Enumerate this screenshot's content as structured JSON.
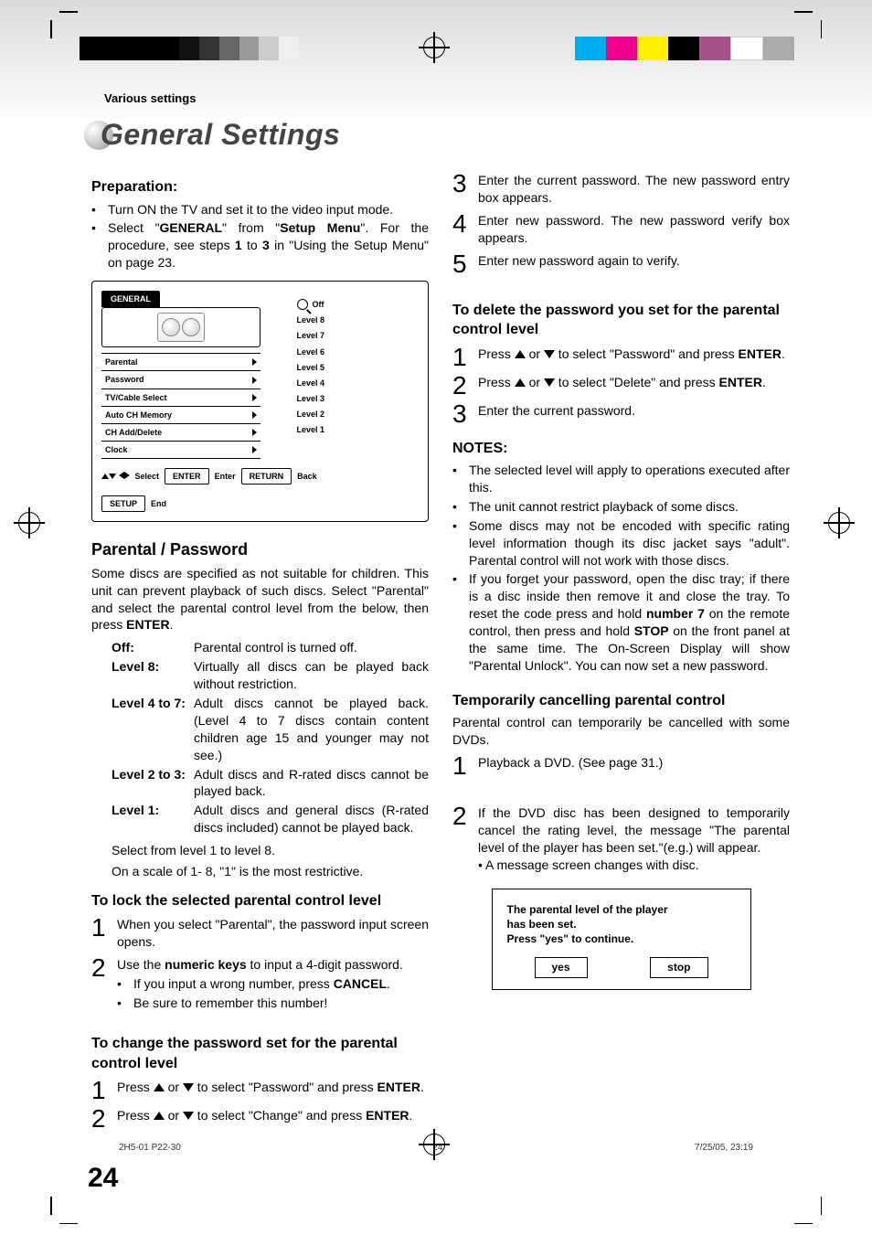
{
  "breadcrumb": "Various settings",
  "title": "General Settings",
  "preparation": {
    "heading": "Preparation:",
    "item1": "Turn ON the TV and set it to the video input mode.",
    "item2_a": "Select \"",
    "item2_b": "GENERAL",
    "item2_c": "\" from \"",
    "item2_d": "Setup Menu",
    "item2_e": "\". For the procedure, see steps ",
    "item2_f": "1",
    "item2_g": " to ",
    "item2_h": "3",
    "item2_i": " in \"Using the Setup Menu\" on page 23."
  },
  "osd": {
    "tab": "GENERAL",
    "menu": [
      "Parental",
      "Password",
      "TV/Cable Select",
      "Auto CH Memory",
      "CH Add/Delete",
      "Clock"
    ],
    "levels": [
      "Off",
      "Level 8",
      "Level 7",
      "Level 6",
      "Level 5",
      "Level 4",
      "Level 3",
      "Level 2",
      "Level 1"
    ],
    "footer": {
      "select": "Select",
      "enter": "ENTER",
      "enter2": "Enter",
      "return": "RETURN",
      "back": "Back",
      "setup": "SETUP",
      "end": "End"
    }
  },
  "section1": {
    "heading": "Parental / Password",
    "intro": "Some discs are specified as not suitable for children. This unit can prevent playback of such discs. Select \"Parental\" and select the parental control level from the below, then press ",
    "introB": "ENTER",
    "introEnd": ".",
    "defs": [
      {
        "k": "Off",
        "colon": ":",
        "v": "Parental control is turned off."
      },
      {
        "k": "Level 8",
        "colon": ":",
        "v": "Virtually all discs can be played back without restriction."
      },
      {
        "k": "Level 4 to 7",
        "colon": ":",
        "v": "Adult discs cannot be played back. (Level 4 to 7 discs contain content children age 15 and younger may not see.)"
      },
      {
        "k": "Level 2 to 3",
        "colon": ":",
        "v": "Adult discs and R-rated discs cannot be played back."
      },
      {
        "k": "Level 1",
        "colon": ":",
        "v": "Adult discs and general discs (R-rated discs included) cannot be played back."
      }
    ],
    "tail1": "Select from level 1 to level 8.",
    "tail2": "On a scale of 1- 8, \"1\" is the most restrictive."
  },
  "lock": {
    "heading": "To lock the selected parental control level",
    "s1": "When you select \"Parental\", the password input screen opens.",
    "s2a": "Use the ",
    "s2b": "numeric keys",
    "s2c": " to input a 4-digit password.",
    "s2d": "If you input a wrong number, press ",
    "s2e": "CANCEL",
    "s2f": ".",
    "s2g": "Be sure to remember this number!"
  },
  "change": {
    "heading": "To change the password set for the parental control level",
    "s1a": "Press ",
    "s1b": " or ",
    "s1c": " to select \"Password\" and press ",
    "s1d": "ENTER",
    "s1e": ".",
    "s2a": "Press ",
    "s2b": " or ",
    "s2c": " to select \"Change\" and press ",
    "s2d": "ENTER",
    "s2e": ".",
    "s3": "Enter the current password. The new password entry box appears.",
    "s4": "Enter new password. The new password verify box appears.",
    "s5": "Enter new password again to verify."
  },
  "delete": {
    "heading": "To delete the password you set for the parental control level",
    "s1a": "Press ",
    "s1b": " or ",
    "s1c": " to select \"Password\" and press ",
    "s1d": "ENTER",
    "s1e": ".",
    "s2a": "Press ",
    "s2b": " or ",
    "s2c": " to select \"Delete\" and press ",
    "s2d": "ENTER",
    "s2e": ".",
    "s3": "Enter the current password."
  },
  "notes": {
    "heading": "NOTES:",
    "items": [
      "The selected level will apply to operations executed after this.",
      "The unit cannot restrict playback of some discs.",
      "Some discs may not be encoded with specific rating level information though its disc jacket says \"adult\". Parental control will not work with those discs."
    ],
    "last_a": "If you forget your password, open the disc tray; if there is a disc inside then remove it and close the tray. To reset the code press and hold ",
    "last_b": "number 7",
    "last_c": " on the remote control, then press and hold ",
    "last_d": "STOP",
    "last_e": " on the front panel at the same time. The On-Screen Display will show \"Parental Unlock\". You can now set a new password."
  },
  "temp": {
    "heading": "Temporarily cancelling parental control",
    "intro": "Parental control can temporarily be cancelled with some DVDs.",
    "s1": "Playback a DVD. (See page 31.)",
    "s2": "If the DVD disc has been designed to temporarily cancel the rating level,  the message \"The parental level of the player has been set.\"(e.g.) will appear.",
    "s2b": "• A message screen changes with disc."
  },
  "dialog": {
    "l1": "The parental level of the player",
    "l2": "has been set.",
    "l3": "Press \"yes\" to continue.",
    "yes": "yes",
    "stop": "stop"
  },
  "pageNumber": "24",
  "footer": {
    "file": "2H5-01 P22-30",
    "page": "24",
    "date": "7/25/05, 23:19"
  }
}
